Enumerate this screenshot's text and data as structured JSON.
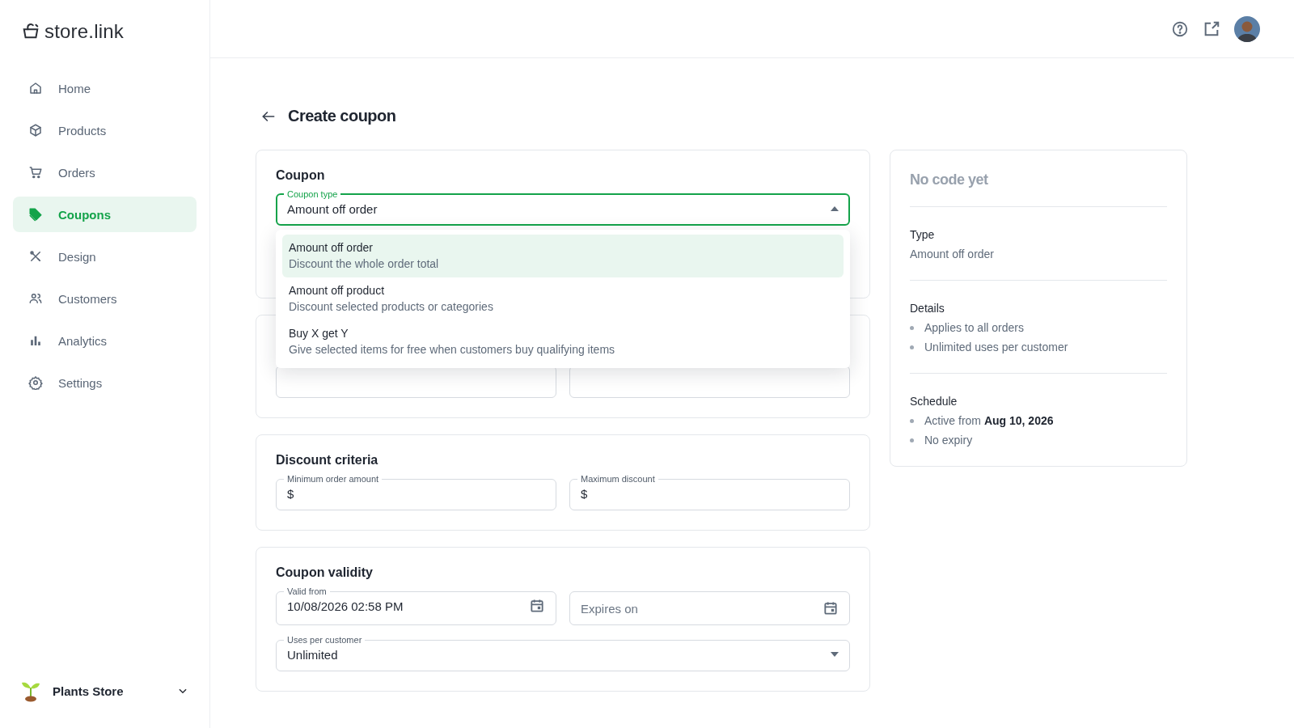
{
  "brand": {
    "name": "store.link"
  },
  "nav": [
    {
      "label": "Home",
      "kind": "home",
      "selected": false
    },
    {
      "label": "Products",
      "kind": "box",
      "selected": false
    },
    {
      "label": "Orders",
      "kind": "cart",
      "selected": false
    },
    {
      "label": "Coupons",
      "kind": "tag",
      "selected": true
    },
    {
      "label": "Design",
      "kind": "tools",
      "selected": false
    },
    {
      "label": "Customers",
      "kind": "people",
      "selected": false
    },
    {
      "label": "Analytics",
      "kind": "chart",
      "selected": false
    },
    {
      "label": "Settings",
      "kind": "gear",
      "selected": false
    }
  ],
  "store": {
    "name": "Plants Store"
  },
  "page": {
    "title": "Create coupon"
  },
  "coupon_card": {
    "title": "Coupon",
    "coupon_type": {
      "label": "Coupon type",
      "value": "Amount off order",
      "expanded": true
    },
    "options": [
      {
        "title": "Amount off order",
        "description": "Discount the whole order total",
        "selected": true
      },
      {
        "title": "Amount off product",
        "description": "Discount selected products or categories",
        "selected": false
      },
      {
        "title": "Buy X get Y",
        "description": "Give selected items for free when customers buy qualifying items",
        "selected": false
      }
    ]
  },
  "criteria_card": {
    "title": "Discount criteria",
    "fields": [
      {
        "label": "Minimum order amount",
        "prefix": "$"
      },
      {
        "label": "Maximum discount",
        "prefix": "$"
      }
    ]
  },
  "validity_card": {
    "title": "Coupon validity",
    "valid_from": {
      "label": "Valid from",
      "value": "10/08/2026 02:58 PM"
    },
    "expires_on": {
      "placeholder": "Expires on"
    },
    "uses_per_customer": {
      "label": "Uses per customer",
      "value": "Unlimited",
      "expanded": false
    }
  },
  "summary": {
    "code": "No code yet",
    "sections": [
      {
        "heading": "Type",
        "text": "Amount off order"
      },
      {
        "heading": "Details",
        "bullets": [
          "Applies to all orders",
          "Unlimited uses per customer"
        ]
      },
      {
        "heading": "Schedule",
        "bullets": [
          "Active from **Aug 10, 2026**",
          "No expiry"
        ]
      }
    ]
  }
}
